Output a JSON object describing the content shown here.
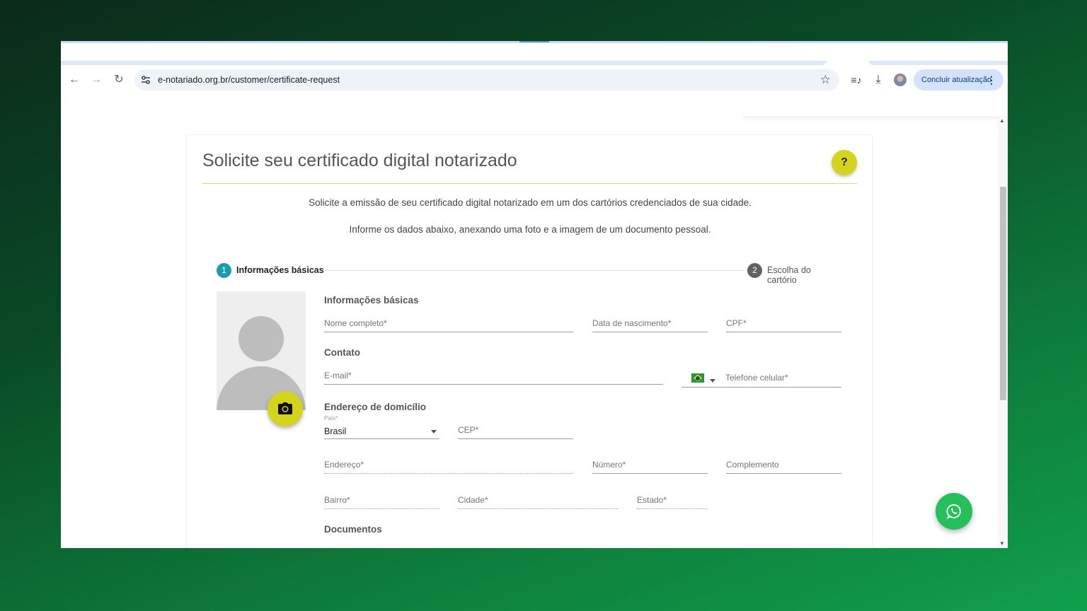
{
  "browser": {
    "url": "e-notariado.org.br/customer/certificate-request",
    "update_label": "Concluir atualização",
    "menu_glyph": "⋮",
    "back_glyph": "←",
    "forward_glyph": "→",
    "reload_glyph": "↻",
    "star_glyph": "☆",
    "media_glyph": "≡♪",
    "download_glyph": "⤓"
  },
  "page": {
    "title": "Solicite seu certificado digital notarizado",
    "help_label": "?",
    "intro_1": "Solicite a emissão de seu certificado digital notarizado em um dos cartórios credenciados de sua cidade.",
    "intro_2": "Informe os dados abaixo, anexando uma foto e a imagem de um documento pessoal.",
    "steps": [
      {
        "number": "1",
        "label": "Informações básicas",
        "active": true
      },
      {
        "number": "2",
        "label": "Escolha do cartório",
        "active": false
      }
    ],
    "sections": {
      "basic": "Informações básicas",
      "contact": "Contato",
      "address": "Endereço de domicílio",
      "documents": "Documentos"
    },
    "fields": {
      "full_name": "Nome completo*",
      "birth_date": "Data de nascimento*",
      "cpf": "CPF*",
      "email": "E-mail*",
      "phone": "Telefone celular*",
      "country_label": "País*",
      "country_value": "Brasil",
      "cep": "CEP*",
      "address": "Endereço*",
      "number": "Número*",
      "complement": "Complemento",
      "district": "Bairro*",
      "city": "Cidade*",
      "state": "Estado*"
    }
  },
  "colors": {
    "accent_yellow": "#d4d41c",
    "step_active": "#1a9bb0",
    "step_inactive": "#616161",
    "whatsapp": "#25c05a",
    "update_chip": "#d3e3fd"
  },
  "icons": {
    "photo_button": "camera-icon",
    "floating_button": "whatsapp-icon",
    "phone_country": "brazil-flag-icon"
  }
}
